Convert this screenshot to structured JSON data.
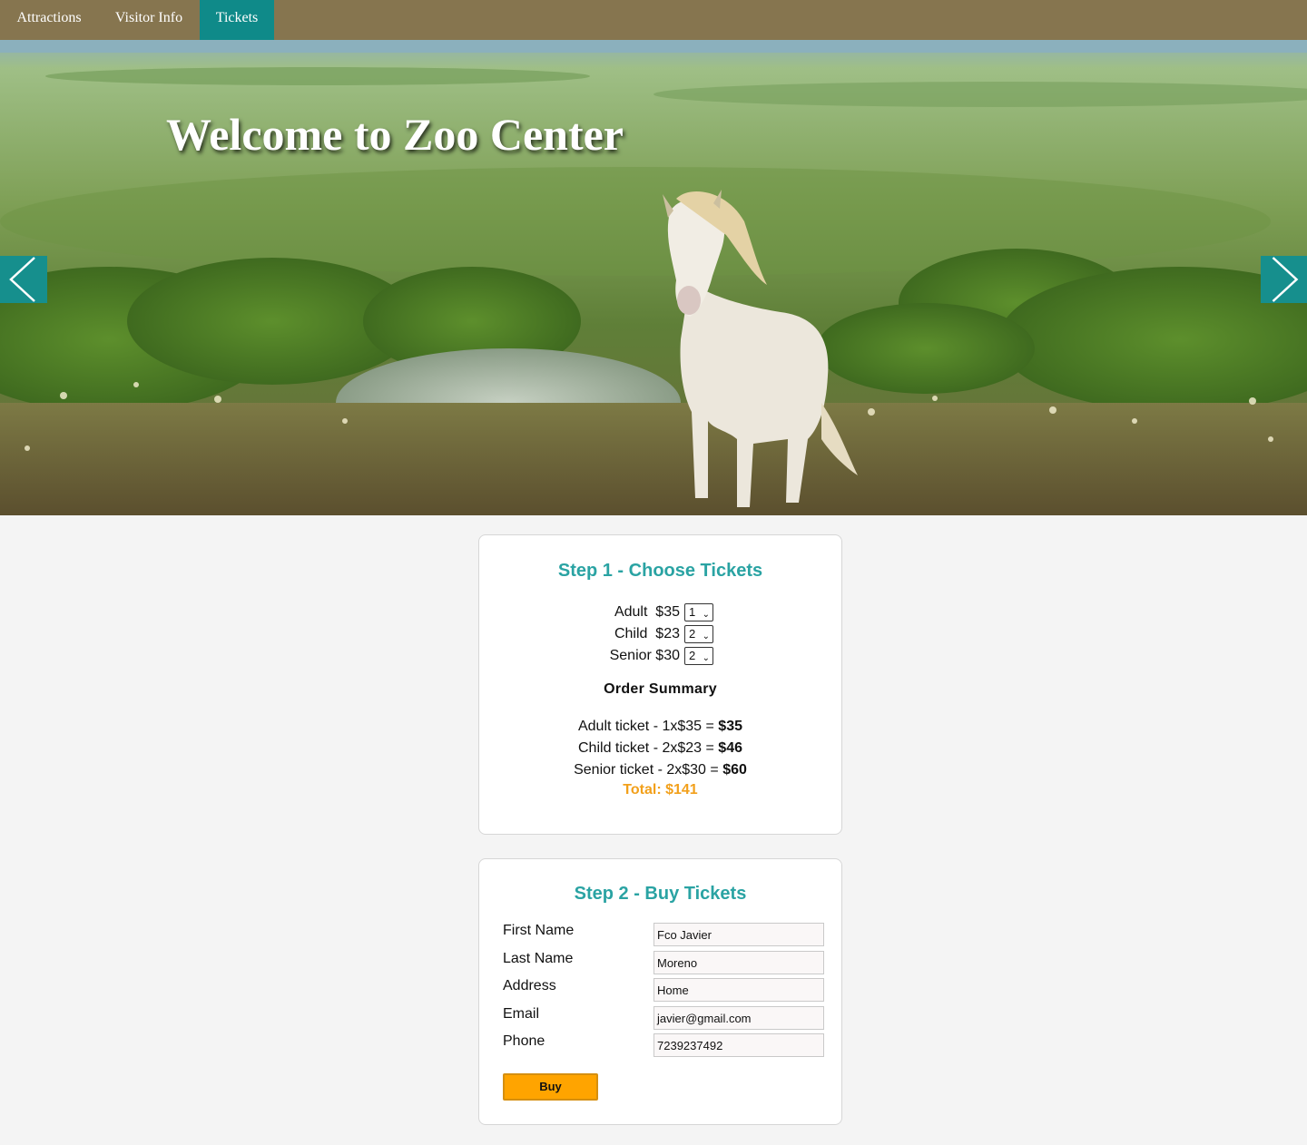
{
  "nav": {
    "items": [
      {
        "label": "Attractions",
        "active": false
      },
      {
        "label": "Visitor Info",
        "active": false
      },
      {
        "label": "Tickets",
        "active": true
      }
    ]
  },
  "hero": {
    "title": "Welcome to Zoo Center",
    "prev_icon": "chevron-left-icon",
    "next_icon": "chevron-right-icon"
  },
  "step1": {
    "title": "Step 1 - Choose Tickets",
    "tickets": [
      {
        "label": "Adult  $35",
        "quantity": "1"
      },
      {
        "label": "Child  $23",
        "quantity": "2"
      },
      {
        "label": "Senior $30",
        "quantity": "2"
      }
    ],
    "summary_title": "Order Summary",
    "summary": [
      {
        "text": "Adult ticket - 1x$35 = ",
        "amount": "$35"
      },
      {
        "text": "Child ticket - 2x$23 = ",
        "amount": "$46"
      },
      {
        "text": "Senior ticket - 2x$30 = ",
        "amount": "$60"
      }
    ],
    "total": "Total: $141"
  },
  "step2": {
    "title": "Step 2 - Buy Tickets",
    "fields": [
      {
        "label": "First Name",
        "value": "Fco Javier"
      },
      {
        "label": "Last Name",
        "value": "Moreno"
      },
      {
        "label": "Address",
        "value": "Home"
      },
      {
        "label": "Email",
        "value": "javier@gmail.com"
      },
      {
        "label": "Phone",
        "value": "7239237492"
      }
    ],
    "buy_label": "Buy"
  },
  "colors": {
    "nav_bg": "#86754f",
    "nav_active": "#0f8a89",
    "heading_teal": "#2aa3a3",
    "total_orange": "#f2a01b",
    "buy_button": "#ffa400"
  }
}
